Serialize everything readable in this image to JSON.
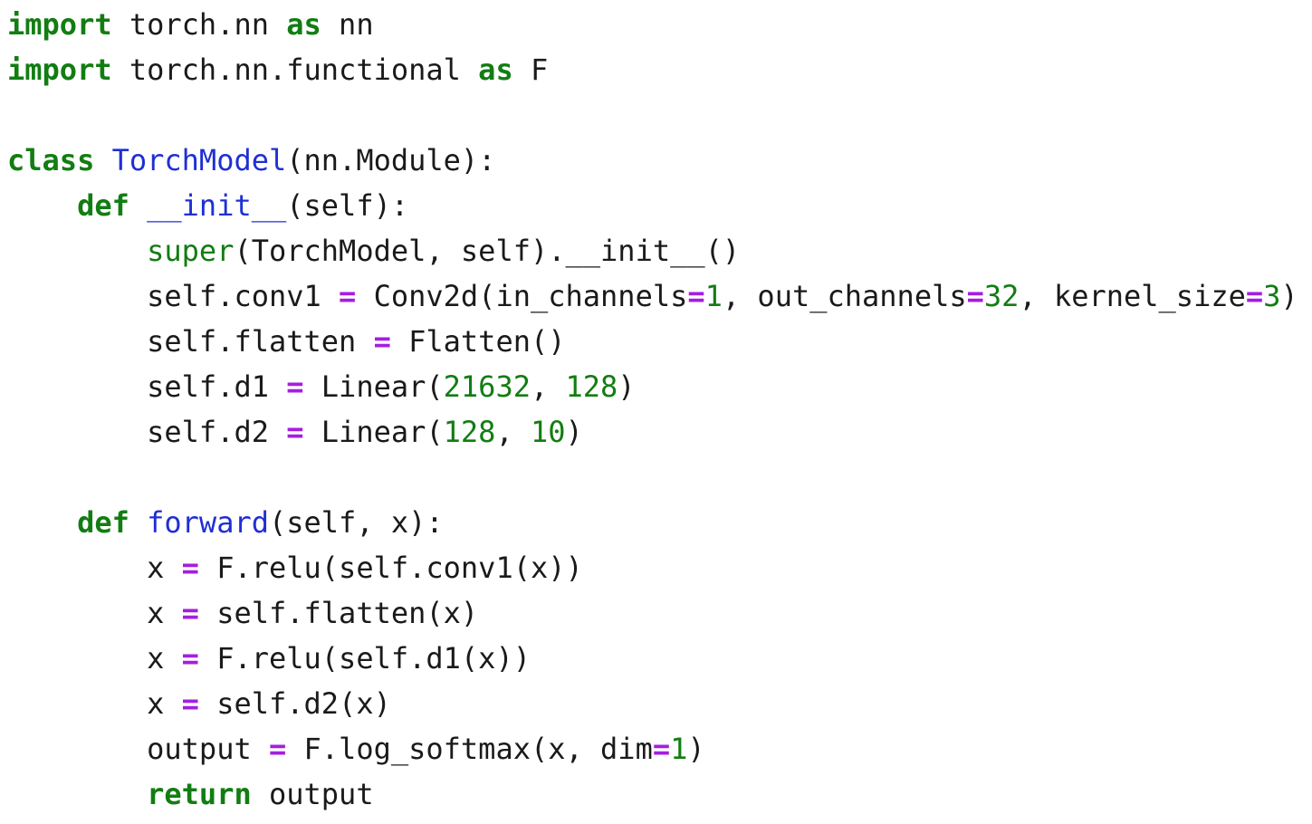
{
  "colors": {
    "keyword": "#127d12",
    "definition_name": "#1f2fd4",
    "builtin": "#127d12",
    "number": "#127d12",
    "operator": "#a51ee0",
    "text": "#1a1a1a",
    "background": "#ffffff"
  },
  "lines": [
    [
      {
        "t": "keyword",
        "v": "import"
      },
      {
        "t": "text",
        "v": " torch.nn "
      },
      {
        "t": "keyword",
        "v": "as"
      },
      {
        "t": "text",
        "v": " nn"
      }
    ],
    [
      {
        "t": "keyword",
        "v": "import"
      },
      {
        "t": "text",
        "v": " torch.nn.functional "
      },
      {
        "t": "keyword",
        "v": "as"
      },
      {
        "t": "text",
        "v": " F"
      }
    ],
    [],
    [
      {
        "t": "keyword",
        "v": "class"
      },
      {
        "t": "text",
        "v": " "
      },
      {
        "t": "def-name",
        "v": "TorchModel"
      },
      {
        "t": "text",
        "v": "(nn.Module):"
      }
    ],
    [
      {
        "t": "text",
        "v": "    "
      },
      {
        "t": "keyword",
        "v": "def"
      },
      {
        "t": "text",
        "v": " "
      },
      {
        "t": "def-name",
        "v": "__init__"
      },
      {
        "t": "text",
        "v": "(self):"
      }
    ],
    [
      {
        "t": "text",
        "v": "        "
      },
      {
        "t": "builtin",
        "v": "super"
      },
      {
        "t": "text",
        "v": "(TorchModel, self).__init__()"
      }
    ],
    [
      {
        "t": "text",
        "v": "        self.conv1 "
      },
      {
        "t": "operator",
        "v": "="
      },
      {
        "t": "text",
        "v": " Conv2d(in_channels"
      },
      {
        "t": "operator",
        "v": "="
      },
      {
        "t": "number",
        "v": "1"
      },
      {
        "t": "text",
        "v": ", out_channels"
      },
      {
        "t": "operator",
        "v": "="
      },
      {
        "t": "number",
        "v": "32"
      },
      {
        "t": "text",
        "v": ", kernel_size"
      },
      {
        "t": "operator",
        "v": "="
      },
      {
        "t": "number",
        "v": "3"
      },
      {
        "t": "text",
        "v": ")"
      }
    ],
    [
      {
        "t": "text",
        "v": "        self.flatten "
      },
      {
        "t": "operator",
        "v": "="
      },
      {
        "t": "text",
        "v": " Flatten()"
      }
    ],
    [
      {
        "t": "text",
        "v": "        self.d1 "
      },
      {
        "t": "operator",
        "v": "="
      },
      {
        "t": "text",
        "v": " Linear("
      },
      {
        "t": "number",
        "v": "21632"
      },
      {
        "t": "text",
        "v": ", "
      },
      {
        "t": "number",
        "v": "128"
      },
      {
        "t": "text",
        "v": ")"
      }
    ],
    [
      {
        "t": "text",
        "v": "        self.d2 "
      },
      {
        "t": "operator",
        "v": "="
      },
      {
        "t": "text",
        "v": " Linear("
      },
      {
        "t": "number",
        "v": "128"
      },
      {
        "t": "text",
        "v": ", "
      },
      {
        "t": "number",
        "v": "10"
      },
      {
        "t": "text",
        "v": ")"
      }
    ],
    [],
    [
      {
        "t": "text",
        "v": "    "
      },
      {
        "t": "keyword",
        "v": "def"
      },
      {
        "t": "text",
        "v": " "
      },
      {
        "t": "def-name",
        "v": "forward"
      },
      {
        "t": "text",
        "v": "(self, x):"
      }
    ],
    [
      {
        "t": "text",
        "v": "        x "
      },
      {
        "t": "operator",
        "v": "="
      },
      {
        "t": "text",
        "v": " F.relu(self.conv1(x))"
      }
    ],
    [
      {
        "t": "text",
        "v": "        x "
      },
      {
        "t": "operator",
        "v": "="
      },
      {
        "t": "text",
        "v": " self.flatten(x)"
      }
    ],
    [
      {
        "t": "text",
        "v": "        x "
      },
      {
        "t": "operator",
        "v": "="
      },
      {
        "t": "text",
        "v": " F.relu(self.d1(x))"
      }
    ],
    [
      {
        "t": "text",
        "v": "        x "
      },
      {
        "t": "operator",
        "v": "="
      },
      {
        "t": "text",
        "v": " self.d2(x)"
      }
    ],
    [
      {
        "t": "text",
        "v": "        output "
      },
      {
        "t": "operator",
        "v": "="
      },
      {
        "t": "text",
        "v": " F.log_softmax(x, dim"
      },
      {
        "t": "operator",
        "v": "="
      },
      {
        "t": "number",
        "v": "1"
      },
      {
        "t": "text",
        "v": ")"
      }
    ],
    [
      {
        "t": "text",
        "v": "        "
      },
      {
        "t": "keyword",
        "v": "return"
      },
      {
        "t": "text",
        "v": " output"
      }
    ]
  ]
}
